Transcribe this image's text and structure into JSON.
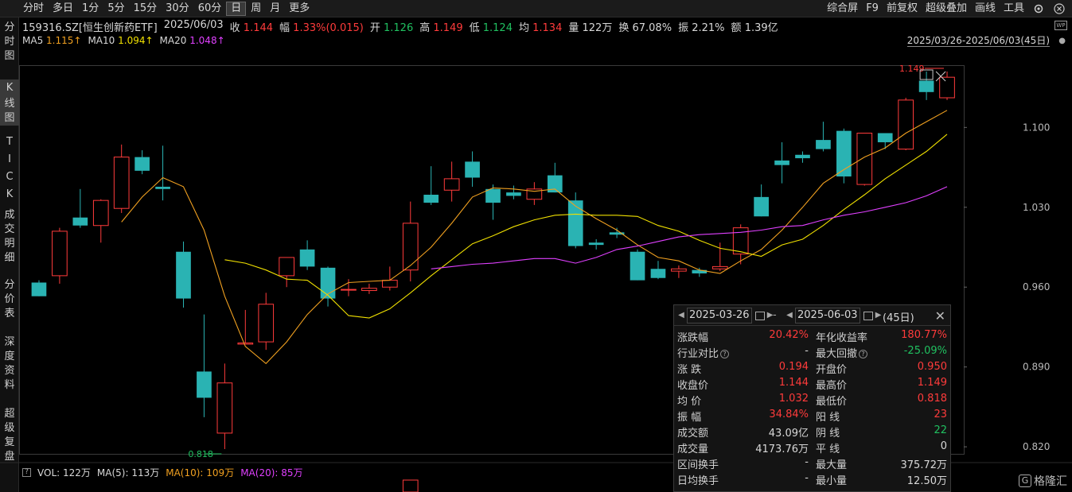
{
  "toolbar": {
    "periods": [
      "分时",
      "多日",
      "1分",
      "5分",
      "15分",
      "30分",
      "60分",
      "日",
      "周",
      "月",
      "更多"
    ],
    "active_period": "日",
    "tools": [
      "综合屏",
      "F9",
      "前复权",
      "超级叠加",
      "画线",
      "工具"
    ]
  },
  "sidebar": {
    "items": [
      {
        "label": "分时图",
        "active": false
      },
      {
        "label": "K线图",
        "active": true
      },
      {
        "label": "TICK",
        "active": false
      },
      {
        "label": "成交明细",
        "active": false
      },
      {
        "label": "分价表",
        "active": false
      },
      {
        "label": "深度资料",
        "active": false
      },
      {
        "label": "超级复盘",
        "active": false
      }
    ]
  },
  "quote": {
    "symbol": "159316.SZ[恒生创新药ETF]",
    "date": "2025/06/03",
    "close_label": "收",
    "close": "1.144",
    "change_label": "幅",
    "change": "1.33%(0.015)",
    "open_label": "开",
    "open": "1.126",
    "high_label": "高",
    "high": "1.149",
    "low_label": "低",
    "low": "1.124",
    "avg_label": "均",
    "avg": "1.134",
    "vol_label": "量",
    "vol": "122万",
    "turnover_label": "换",
    "turnover": "67.08%",
    "amplitude_label": "振",
    "amplitude": "2.21%",
    "amount_label": "额",
    "amount": "1.39亿"
  },
  "ma": {
    "ma5_label": "MA5",
    "ma5": "1.115↑",
    "ma10_label": "MA10",
    "ma10": "1.094↑",
    "ma20_label": "MA20",
    "ma20": "1.048↑"
  },
  "range_label": "2025/03/26-2025/06/03(45日)",
  "wp_badge": "WP",
  "price_labels": {
    "high_mark": "1.149",
    "low_mark": "0.818"
  },
  "volume": {
    "label": "VOL: 122万",
    "ma5": "MA(5): 113万",
    "ma10": "MA(10): 109万",
    "ma20": "MA(20): 85万",
    "help": "?"
  },
  "stats": {
    "start_date": "2025-03-26",
    "end_date": "2025-06-03",
    "separator": "-",
    "days": "(45日)",
    "rows": [
      {
        "l1": "涨跌幅",
        "v1": "20.42%",
        "c1": "red",
        "l2": "年化收益率",
        "v2": "180.77%",
        "c2": "red"
      },
      {
        "l1": "行业对比",
        "v1": "-",
        "c1": "white",
        "l2": "最大回撤",
        "v2": "-25.09%",
        "c2": "green",
        "help1": true,
        "help2": true
      },
      {
        "l1": "涨  跌",
        "v1": "0.194",
        "c1": "red",
        "l2": "开盘价",
        "v2": "0.950",
        "c2": "red"
      },
      {
        "l1": "收盘价",
        "v1": "1.144",
        "c1": "red",
        "l2": "最高价",
        "v2": "1.149",
        "c2": "red"
      },
      {
        "l1": "均  价",
        "v1": "1.032",
        "c1": "red",
        "l2": "最低价",
        "v2": "0.818",
        "c2": "red"
      },
      {
        "l1": "振  幅",
        "v1": "34.84%",
        "c1": "red",
        "l2": "阳  线",
        "v2": "23",
        "c2": "red"
      },
      {
        "l1": "成交额",
        "v1": "43.09亿",
        "c1": "white",
        "l2": "阴  线",
        "v2": "22",
        "c2": "green"
      },
      {
        "l1": "成交量",
        "v1": "4173.76万",
        "c1": "white",
        "l2": "平  线",
        "v2": "0",
        "c2": "white"
      },
      {
        "l1": "区间换手",
        "v1": "-",
        "c1": "white",
        "l2": "最大量",
        "v2": "375.72万",
        "c2": "white"
      },
      {
        "l1": "日均换手",
        "v1": "-",
        "c1": "white",
        "l2": "最小量",
        "v2": "12.50万",
        "c2": "white"
      }
    ]
  },
  "brand": {
    "logo": "G",
    "name": "格隆汇"
  },
  "colors": {
    "up": "#ff3b3b",
    "down": "#2ab3b3",
    "ma5": "#f0a020",
    "ma10": "#f0e000",
    "ma20": "#e040ff",
    "grid": "#2a2a2a"
  },
  "chart_data": {
    "type": "candlestick",
    "y_ticks": [
      "1.100",
      "1.030",
      "0.960",
      "0.890",
      "0.820"
    ],
    "y_tick_values": [
      1.1,
      1.03,
      0.96,
      0.89,
      0.82
    ],
    "ylim": [
      0.818,
      1.149
    ],
    "candles": [
      {
        "o": 0.964,
        "h": 0.966,
        "l": 0.952,
        "c": 0.952
      },
      {
        "o": 0.97,
        "h": 1.012,
        "l": 0.963,
        "c": 1.009
      },
      {
        "o": 1.021,
        "h": 1.046,
        "l": 1.012,
        "c": 1.014
      },
      {
        "o": 1.014,
        "h": 1.037,
        "l": 0.999,
        "c": 1.036
      },
      {
        "o": 1.029,
        "h": 1.085,
        "l": 1.025,
        "c": 1.074
      },
      {
        "o": 1.074,
        "h": 1.08,
        "l": 1.059,
        "c": 1.062
      },
      {
        "o": 1.048,
        "h": 1.084,
        "l": 1.036,
        "c": 1.046
      },
      {
        "o": 0.991,
        "h": 1.0,
        "l": 0.942,
        "c": 0.95
      },
      {
        "o": 0.886,
        "h": 0.936,
        "l": 0.846,
        "c": 0.863
      },
      {
        "o": 0.832,
        "h": 0.893,
        "l": 0.818,
        "c": 0.876
      },
      {
        "o": 0.91,
        "h": 0.94,
        "l": 0.91,
        "c": 0.911
      },
      {
        "o": 0.912,
        "h": 0.955,
        "l": 0.905,
        "c": 0.945
      },
      {
        "o": 0.97,
        "h": 0.983,
        "l": 0.96,
        "c": 0.986
      },
      {
        "o": 0.993,
        "h": 1.001,
        "l": 0.975,
        "c": 0.978
      },
      {
        "o": 0.977,
        "h": 0.978,
        "l": 0.943,
        "c": 0.95
      },
      {
        "o": 0.958,
        "h": 0.967,
        "l": 0.952,
        "c": 0.958
      },
      {
        "o": 0.957,
        "h": 0.963,
        "l": 0.954,
        "c": 0.959
      },
      {
        "o": 0.96,
        "h": 0.978,
        "l": 0.957,
        "c": 0.966
      },
      {
        "o": 0.975,
        "h": 1.035,
        "l": 0.965,
        "c": 1.016
      },
      {
        "o": 1.041,
        "h": 1.066,
        "l": 1.032,
        "c": 1.034
      },
      {
        "o": 1.045,
        "h": 1.07,
        "l": 1.035,
        "c": 1.055
      },
      {
        "o": 1.07,
        "h": 1.079,
        "l": 1.048,
        "c": 1.056
      },
      {
        "o": 1.046,
        "h": 1.05,
        "l": 1.019,
        "c": 1.034
      },
      {
        "o": 1.043,
        "h": 1.049,
        "l": 1.037,
        "c": 1.04
      },
      {
        "o": 1.037,
        "h": 1.052,
        "l": 1.032,
        "c": 1.046
      },
      {
        "o": 1.058,
        "h": 1.069,
        "l": 1.045,
        "c": 1.043
      },
      {
        "o": 1.036,
        "h": 1.043,
        "l": 0.994,
        "c": 0.996
      },
      {
        "o": 0.999,
        "h": 1.002,
        "l": 0.993,
        "c": 0.997
      },
      {
        "o": 1.008,
        "h": 1.012,
        "l": 1.003,
        "c": 1.006
      },
      {
        "o": 0.991,
        "h": 0.993,
        "l": 0.968,
        "c": 0.966
      },
      {
        "o": 0.976,
        "h": 0.983,
        "l": 0.967,
        "c": 0.968
      },
      {
        "o": 0.974,
        "h": 0.979,
        "l": 0.968,
        "c": 0.976
      },
      {
        "o": 0.975,
        "h": 0.977,
        "l": 0.969,
        "c": 0.972
      },
      {
        "o": 0.976,
        "h": 0.999,
        "l": 0.974,
        "c": 0.978
      },
      {
        "o": 0.989,
        "h": 1.015,
        "l": 0.98,
        "c": 1.012
      },
      {
        "o": 1.039,
        "h": 1.05,
        "l": 1.022,
        "c": 1.022
      },
      {
        "o": 1.071,
        "h": 1.087,
        "l": 1.051,
        "c": 1.067
      },
      {
        "o": 1.076,
        "h": 1.079,
        "l": 1.069,
        "c": 1.073
      },
      {
        "o": 1.089,
        "h": 1.105,
        "l": 1.079,
        "c": 1.081
      },
      {
        "o": 1.097,
        "h": 1.099,
        "l": 1.051,
        "c": 1.057
      },
      {
        "o": 1.05,
        "h": 1.088,
        "l": 1.049,
        "c": 1.095
      },
      {
        "o": 1.095,
        "h": 1.084,
        "l": 1.081,
        "c": 1.087
      },
      {
        "o": 1.081,
        "h": 1.126,
        "l": 1.08,
        "c": 1.124
      },
      {
        "o": 1.141,
        "h": 1.149,
        "l": 1.124,
        "c": 1.131
      },
      {
        "o": 1.126,
        "h": 1.149,
        "l": 1.124,
        "c": 1.144
      }
    ],
    "ma5": [
      null,
      null,
      null,
      null,
      1.017,
      1.039,
      1.056,
      1.048,
      1.01,
      0.952,
      0.908,
      0.893,
      0.912,
      0.936,
      0.954,
      0.964,
      0.965,
      0.966,
      0.979,
      0.995,
      1.016,
      1.039,
      1.047,
      1.046,
      1.044,
      1.046,
      1.031,
      1.02,
      1.01,
      0.997,
      0.986,
      0.983,
      0.975,
      0.972,
      0.983,
      0.993,
      1.01,
      1.03,
      1.051,
      1.063,
      1.074,
      1.082,
      1.095,
      1.105,
      1.115
    ],
    "ma10": [
      null,
      null,
      null,
      null,
      null,
      null,
      null,
      null,
      null,
      0.984,
      0.981,
      0.975,
      0.967,
      0.966,
      0.953,
      0.935,
      0.933,
      0.941,
      0.955,
      0.97,
      0.984,
      0.998,
      1.005,
      1.013,
      1.019,
      1.023,
      1.024,
      1.023,
      1.023,
      1.022,
      1.014,
      1.009,
      1.001,
      0.994,
      0.991,
      0.987,
      0.997,
      1.002,
      1.014,
      1.028,
      1.041,
      1.055,
      1.067,
      1.079,
      1.094
    ],
    "ma20": [
      null,
      null,
      null,
      null,
      null,
      null,
      null,
      null,
      null,
      null,
      null,
      null,
      null,
      null,
      null,
      null,
      null,
      null,
      null,
      0.976,
      0.978,
      0.98,
      0.981,
      0.983,
      0.985,
      0.985,
      0.981,
      0.986,
      0.993,
      0.996,
      1.0,
      1.004,
      1.006,
      1.007,
      1.008,
      1.01,
      1.013,
      1.014,
      1.019,
      1.023,
      1.026,
      1.03,
      1.034,
      1.04,
      1.048
    ]
  }
}
